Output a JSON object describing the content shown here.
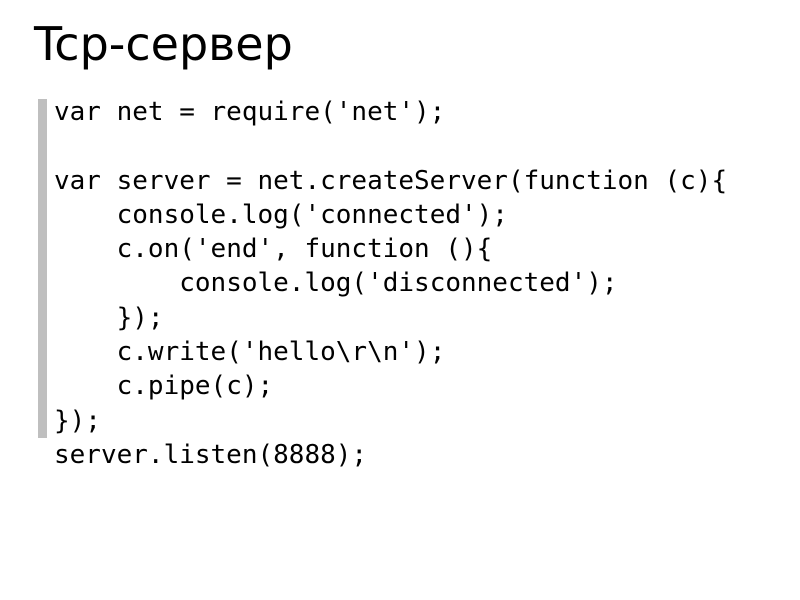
{
  "title": "Tcp-сервер",
  "code": "var net = require('net');\n\nvar server = net.createServer(function (c){\n    console.log('connected');\n    c.on('end', function (){\n        console.log('disconnected');\n    });\n    c.write('hello\\r\\n');\n    c.pipe(c);\n});\nserver.listen(8888);"
}
